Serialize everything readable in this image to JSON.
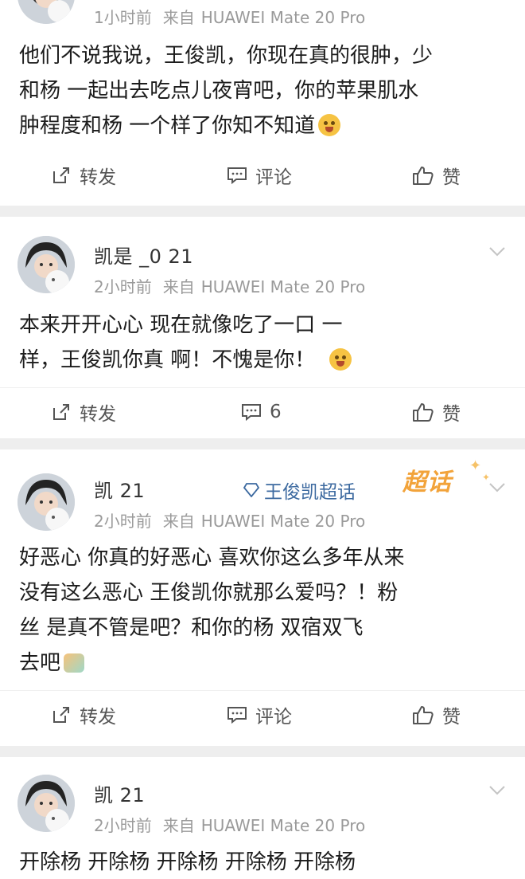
{
  "posts": [
    {
      "username": "",
      "time": "1小时前",
      "from": "来自",
      "device": "HUAWEI Mate 20 Pro",
      "lines": [
        "他们不说我说，王俊凯，你现在真的很肿，少",
        "和杨  一起出去吃点儿夜宵吧，你的苹果肌水",
        "肿程度和杨  一个样了你知不知道"
      ],
      "actions": {
        "repost": "转发",
        "comment": "评论",
        "like": "赞"
      }
    },
    {
      "username": "凯是  _0 21",
      "time": "2小时前",
      "from": "来自",
      "device": "HUAWEI Mate 20 Pro",
      "lines": [
        "本来开开心心  现在就像吃了一口  一",
        "样，王俊凯你真  啊！不愧是你！"
      ],
      "actions": {
        "repost": "转发",
        "comment": "6",
        "like": "赞"
      }
    },
    {
      "username": "凯  21",
      "supertopic": "王俊凯超话",
      "badge": "超话",
      "time": "2小时前",
      "from": "来自",
      "device": "HUAWEI Mate 20 Pro",
      "lines": [
        "好恶心  你真的好恶心  喜欢你这么多年从来",
        "没有这么恶心  王俊凯你就那么爱吗？！粉",
        "丝  是真不管是吧？和你的杨  双宿双飞",
        "去吧"
      ],
      "actions": {
        "repost": "转发",
        "comment": "评论",
        "like": "赞"
      }
    },
    {
      "username": "凯  21",
      "time": "2小时前",
      "from": "来自",
      "device": "HUAWEI Mate 20 Pro",
      "lines": [
        "开除杨  开除杨  开除杨  开除杨  开除杨"
      ]
    }
  ],
  "colors": {
    "meta": "#9a9a9a",
    "link": "#3d6aa0",
    "badge": "#f2a33a",
    "separator": "#eeeeee"
  },
  "icons": {
    "repost": "edit-share-icon",
    "comment": "comment-box-icon",
    "like": "thumbs-up-icon",
    "menu": "chevron-down-icon"
  }
}
